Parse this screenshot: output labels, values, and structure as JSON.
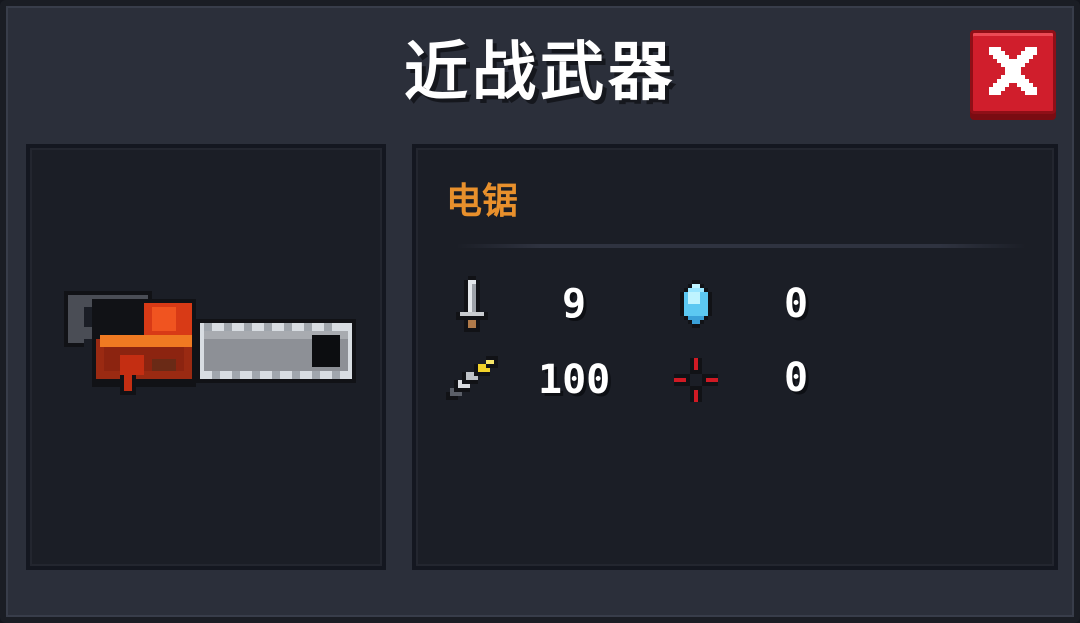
{
  "dialog": {
    "title": "近战武器",
    "close_icon": "close-x-icon"
  },
  "weapon": {
    "name": "电锯",
    "image": "chainsaw-sprite",
    "name_color": "#e8902c"
  },
  "stats": {
    "damage": {
      "icon": "sword-icon",
      "value": "9"
    },
    "energy": {
      "icon": "energy-crystal-icon",
      "value": "0"
    },
    "accuracy": {
      "icon": "quill-icon",
      "value": "100"
    },
    "crit": {
      "icon": "crosshair-icon",
      "value": "0"
    }
  },
  "colors": {
    "panel_bg": "#2b2f3a",
    "inner_panel_bg": "#1b1e26",
    "close_button": "#d01e2c",
    "accent": "#e8902c"
  }
}
